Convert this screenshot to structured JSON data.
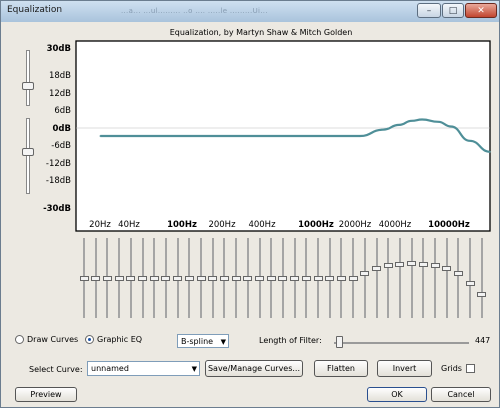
{
  "window": {
    "title": "Equalization",
    "ghost_text": "...a... ...ul......... ..o .... .....le .........Ui..."
  },
  "window_buttons": {
    "minimize": "–",
    "maximize": "□",
    "close": "✕"
  },
  "chart": {
    "title": "Equalization, by Martyn Shaw & Mitch Golden",
    "y_labels": [
      "30dB",
      "18dB",
      "12dB",
      "6dB",
      "0dB",
      "-6dB",
      "-12dB",
      "-18dB",
      "-30dB"
    ],
    "x_labels": [
      "20Hz",
      "40Hz",
      "100Hz",
      "200Hz",
      "400Hz",
      "1000Hz",
      "2000Hz",
      "4000Hz",
      "10000Hz"
    ],
    "line_color": "#4f8f98"
  },
  "chart_data": {
    "type": "line",
    "title": "Equalization, by Martyn Shaw & Mitch Golden",
    "x": [
      "20Hz",
      "40Hz",
      "100Hz",
      "200Hz",
      "400Hz",
      "1000Hz",
      "2000Hz",
      "3000Hz",
      "4000Hz",
      "5000Hz",
      "6000Hz",
      "8000Hz",
      "10000Hz",
      "14000Hz",
      "20000Hz"
    ],
    "series": [
      {
        "values": [
          0,
          0,
          0,
          0,
          0,
          0,
          0,
          2,
          3.5,
          4.8,
          5.2,
          4.5,
          3,
          -1.5,
          -5
        ]
      }
    ],
    "xlabel": "",
    "ylabel": "",
    "ylim": [
      -30,
      30
    ],
    "grid": false
  },
  "eq_sliders": {
    "positions": [
      0.5,
      0.5,
      0.5,
      0.5,
      0.5,
      0.5,
      0.5,
      0.5,
      0.5,
      0.5,
      0.5,
      0.5,
      0.5,
      0.5,
      0.5,
      0.5,
      0.5,
      0.5,
      0.5,
      0.5,
      0.5,
      0.5,
      0.5,
      0.5,
      0.56,
      0.62,
      0.66,
      0.68,
      0.69,
      0.68,
      0.66,
      0.62,
      0.56,
      0.44,
      0.3
    ]
  },
  "controls": {
    "draw_curves_label": "Draw Curves",
    "graphic_eq_label": "Graphic EQ",
    "interp_value": "B-spline",
    "length_label": "Length of Filter:",
    "length_value": "447",
    "select_curve_label": "Select Curve:",
    "curve_value": "unnamed",
    "save_manage_label": "Save/Manage Curves...",
    "flatten_label": "Flatten",
    "invert_label": "Invert",
    "grids_label": "Grids",
    "preview_label": "Preview",
    "ok_label": "OK",
    "cancel_label": "Cancel"
  }
}
